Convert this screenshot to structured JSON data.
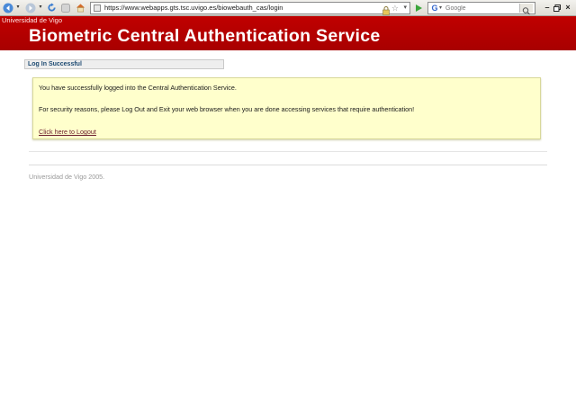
{
  "browser": {
    "url": "https://www.webapps.gts.tsc.uvigo.es/biowebauth_cas/login",
    "search_placeholder": "Google",
    "icons": [
      "back-icon",
      "forward-icon",
      "reload-icon",
      "stop-icon",
      "home-icon",
      "lock-icon",
      "star-icon",
      "go-icon",
      "google-icon",
      "search-icon"
    ]
  },
  "header": {
    "organization": "Universidad de Vigo",
    "title": "Biometric Central Authentication Service",
    "background_color": "#b80000"
  },
  "status": {
    "tab_label": "Log In Successful"
  },
  "message": {
    "line1": "You have successfully logged into the Central Authentication Service.",
    "line2": "For security reasons, please Log Out and Exit your web browser when you are done accessing services that require authentication!",
    "logout_link": "Click here to Logout",
    "background_color": "#ffffcc"
  },
  "footer": {
    "copyright": "Universidad de Vigo 2005."
  }
}
